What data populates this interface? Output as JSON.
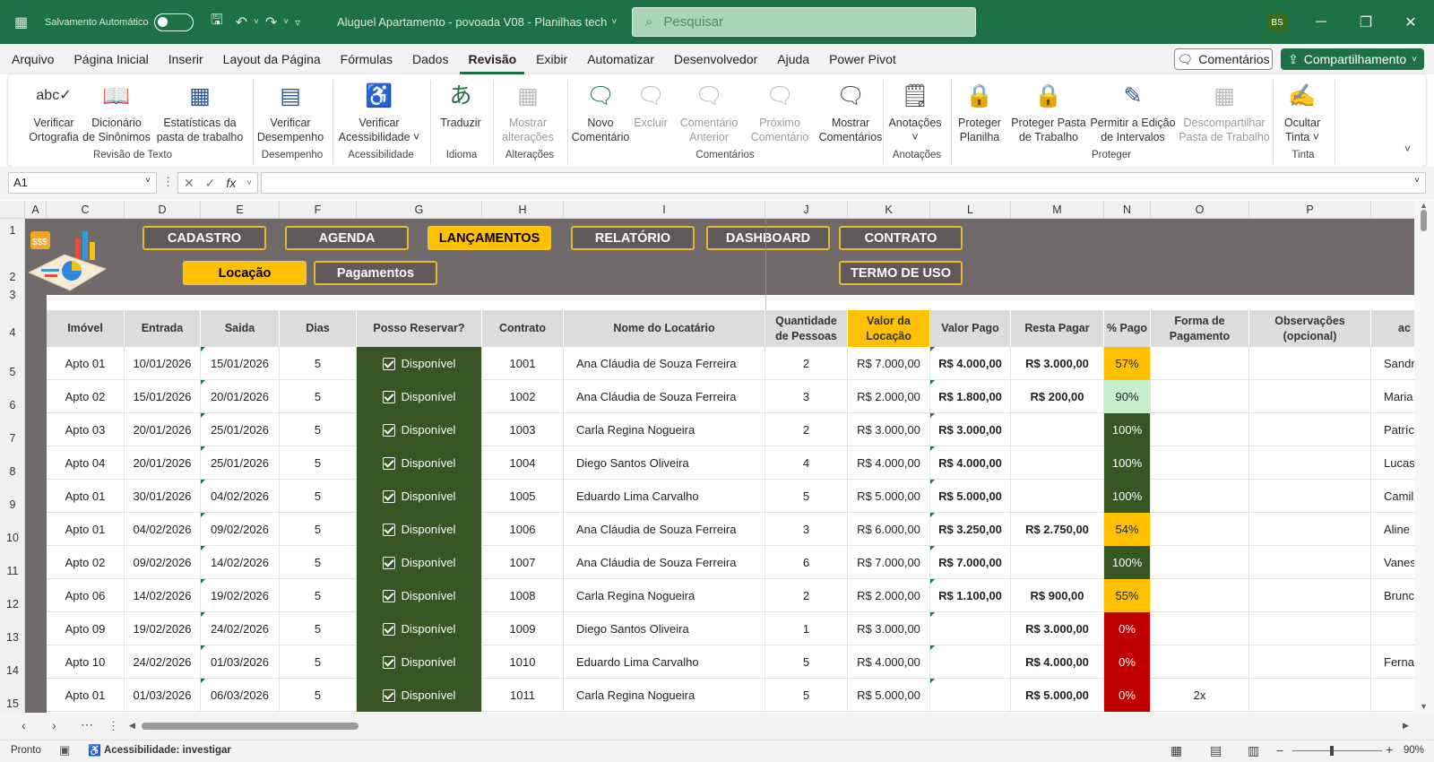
{
  "titlebar": {
    "autosave_label": "Salvamento Automático",
    "doc_title": "Aluguel Apartamento - povoada V08 - Planilhas tech",
    "search_placeholder": "Pesquisar",
    "avatar": "BS"
  },
  "menu": {
    "items": [
      "Arquivo",
      "Página Inicial",
      "Inserir",
      "Layout da Página",
      "Fórmulas",
      "Dados",
      "Revisão",
      "Exibir",
      "Automatizar",
      "Desenvolvedor",
      "Ajuda",
      "Power Pivot"
    ],
    "active": "Revisão",
    "comments_btn": "Comentários",
    "share_btn": "Compartilhamento"
  },
  "ribbon": {
    "items": [
      {
        "label1": "Verificar",
        "label2": "Ortografia",
        "icon": "abc"
      },
      {
        "label1": "Dicionário",
        "label2": "de Sinônimos",
        "icon": "book"
      },
      {
        "label1": "Estatísticas da",
        "label2": "pasta de trabalho",
        "icon": "123"
      },
      {
        "label1": "Verificar",
        "label2": "Desempenho",
        "icon": "perf"
      },
      {
        "label1": "Verificar",
        "label2": "Acessibilidade ˅",
        "icon": "access"
      },
      {
        "label1": "Traduzir",
        "label2": "",
        "icon": "translate"
      },
      {
        "label1": "Mostrar",
        "label2": "alterações",
        "icon": "changes"
      },
      {
        "label1": "Novo",
        "label2": "Comentário",
        "icon": "newcomment"
      },
      {
        "label1": "Excluir",
        "label2": "",
        "icon": "delete"
      },
      {
        "label1": "Comentário",
        "label2": "Anterior",
        "icon": "prev"
      },
      {
        "label1": "Próximo",
        "label2": "Comentário",
        "icon": "next"
      },
      {
        "label1": "Mostrar",
        "label2": "Comentários",
        "icon": "showcomments"
      },
      {
        "label1": "Anotações",
        "label2": "˅",
        "icon": "notes"
      },
      {
        "label1": "Proteger",
        "label2": "Planilha",
        "icon": "protect"
      },
      {
        "label1": "Proteger Pasta",
        "label2": "de Trabalho",
        "icon": "protectwb"
      },
      {
        "label1": "Permitir a Edição",
        "label2": "de Intervalos",
        "icon": "allow"
      },
      {
        "label1": "Descompartilhar",
        "label2": "Pasta de Trabalho",
        "icon": "unshare"
      },
      {
        "label1": "Ocultar",
        "label2": "Tinta ˅",
        "icon": "ink"
      }
    ],
    "groups": [
      "Revisão de Texto",
      "Desempenho",
      "Acessibilidade",
      "Idioma",
      "Alterações",
      "Comentários",
      "Anotações",
      "Proteger",
      "Tinta"
    ]
  },
  "formula": {
    "namebox": "A1",
    "value": ""
  },
  "columns": [
    "A",
    "C",
    "D",
    "E",
    "F",
    "G",
    "H",
    "I",
    "J",
    "K",
    "L",
    "M",
    "N",
    "O",
    "P"
  ],
  "rows": [
    "1",
    "2",
    "3",
    "4",
    "5",
    "6",
    "7",
    "8",
    "9",
    "10",
    "11",
    "12",
    "13",
    "14",
    "15"
  ],
  "nav": {
    "cadastro": "CADASTRO",
    "agenda": "AGENDA",
    "lancamentos": "LANÇAMENTOS",
    "relatorio": "RELATÓRIO",
    "dashboard": "DASHBOARD",
    "contrato": "CONTRATO",
    "locacao": "Locação",
    "pagamentos": "Pagamentos",
    "termo": "TERMO DE USO"
  },
  "table": {
    "headers": [
      "Imóvel",
      "Entrada",
      "Saida",
      "Dias",
      "Posso Reservar?",
      "Contrato",
      "Nome do Locatário",
      "Quantidade de Pessoas",
      "Valor da Locação",
      "Valor Pago",
      "Resta Pagar",
      "% Pago",
      "Forma de Pagamento",
      "Observações (opcional)",
      "ac"
    ],
    "rows": [
      {
        "imovel": "Apto 01",
        "entrada": "10/01/2026",
        "saida": "15/01/2026",
        "dias": "5",
        "reservar": "Disponível",
        "contrato": "1001",
        "nome": "Ana Cláudia de Souza Ferreira",
        "pessoas": "2",
        "valor": "R$ 7.000,00",
        "pago": "R$ 4.000,00",
        "resta": "R$ 3.000,00",
        "pct": "57%",
        "pct_class": "pct-y",
        "forma": "",
        "obs": "",
        "extra": "Sandr"
      },
      {
        "imovel": "Apto 02",
        "entrada": "15/01/2026",
        "saida": "20/01/2026",
        "dias": "5",
        "reservar": "Disponível",
        "contrato": "1002",
        "nome": "Ana Cláudia de Souza Ferreira",
        "pessoas": "3",
        "valor": "R$ 2.000,00",
        "pago": "R$ 1.800,00",
        "resta": "R$ 200,00",
        "pct": "90%",
        "pct_class": "pct-lg",
        "forma": "",
        "obs": "",
        "extra": "Maria"
      },
      {
        "imovel": "Apto 03",
        "entrada": "20/01/2026",
        "saida": "25/01/2026",
        "dias": "5",
        "reservar": "Disponível",
        "contrato": "1003",
        "nome": "Carla Regina Nogueira",
        "pessoas": "2",
        "valor": "R$ 3.000,00",
        "pago": "R$ 3.000,00",
        "resta": "",
        "pct": "100%",
        "pct_class": "pct-dg",
        "forma": "",
        "obs": "",
        "extra": "Patríc"
      },
      {
        "imovel": "Apto 04",
        "entrada": "20/01/2026",
        "saida": "25/01/2026",
        "dias": "5",
        "reservar": "Disponível",
        "contrato": "1004",
        "nome": "Diego Santos Oliveira",
        "pessoas": "4",
        "valor": "R$ 4.000,00",
        "pago": "R$ 4.000,00",
        "resta": "",
        "pct": "100%",
        "pct_class": "pct-dg",
        "forma": "",
        "obs": "",
        "extra": "Lucas"
      },
      {
        "imovel": "Apto 01",
        "entrada": "30/01/2026",
        "saida": "04/02/2026",
        "dias": "5",
        "reservar": "Disponível",
        "contrato": "1005",
        "nome": "Eduardo Lima Carvalho",
        "pessoas": "5",
        "valor": "R$ 5.000,00",
        "pago": "R$ 5.000,00",
        "resta": "",
        "pct": "100%",
        "pct_class": "pct-dg",
        "forma": "",
        "obs": "",
        "extra": "Camil"
      },
      {
        "imovel": "Apto 01",
        "entrada": "04/02/2026",
        "saida": "09/02/2026",
        "dias": "5",
        "reservar": "Disponível",
        "contrato": "1006",
        "nome": "Ana Cláudia de Souza Ferreira",
        "pessoas": "3",
        "valor": "R$ 6.000,00",
        "pago": "R$ 3.250,00",
        "resta": "R$ 2.750,00",
        "pct": "54%",
        "pct_class": "pct-y",
        "forma": "",
        "obs": "",
        "extra": "Aline"
      },
      {
        "imovel": "Apto 02",
        "entrada": "09/02/2026",
        "saida": "14/02/2026",
        "dias": "5",
        "reservar": "Disponível",
        "contrato": "1007",
        "nome": "Ana Cláudia de Souza Ferreira",
        "pessoas": "6",
        "valor": "R$ 7.000,00",
        "pago": "R$ 7.000,00",
        "resta": "",
        "pct": "100%",
        "pct_class": "pct-dg",
        "forma": "",
        "obs": "",
        "extra": "Vanes"
      },
      {
        "imovel": "Apto 06",
        "entrada": "14/02/2026",
        "saida": "19/02/2026",
        "dias": "5",
        "reservar": "Disponível",
        "contrato": "1008",
        "nome": "Carla Regina Nogueira",
        "pessoas": "2",
        "valor": "R$ 2.000,00",
        "pago": "R$ 1.100,00",
        "resta": "R$ 900,00",
        "pct": "55%",
        "pct_class": "pct-y",
        "forma": "",
        "obs": "",
        "extra": "Brunc"
      },
      {
        "imovel": "Apto 09",
        "entrada": "19/02/2026",
        "saida": "24/02/2026",
        "dias": "5",
        "reservar": "Disponível",
        "contrato": "1009",
        "nome": "Diego Santos Oliveira",
        "pessoas": "1",
        "valor": "R$ 3.000,00",
        "pago": "",
        "resta": "R$ 3.000,00",
        "pct": "0%",
        "pct_class": "pct-r",
        "forma": "",
        "obs": "",
        "extra": ""
      },
      {
        "imovel": "Apto 10",
        "entrada": "24/02/2026",
        "saida": "01/03/2026",
        "dias": "5",
        "reservar": "Disponível",
        "contrato": "1010",
        "nome": "Eduardo Lima Carvalho",
        "pessoas": "5",
        "valor": "R$ 4.000,00",
        "pago": "",
        "resta": "R$ 4.000,00",
        "pct": "0%",
        "pct_class": "pct-r",
        "forma": "",
        "obs": "",
        "extra": "Ferna"
      },
      {
        "imovel": "Apto 01",
        "entrada": "01/03/2026",
        "saida": "06/03/2026",
        "dias": "5",
        "reservar": "Disponível",
        "contrato": "1011",
        "nome": "Carla Regina Nogueira",
        "pessoas": "5",
        "valor": "R$ 5.000,00",
        "pago": "",
        "resta": "R$ 5.000,00",
        "pct": "0%",
        "pct_class": "pct-r",
        "forma": "2x",
        "obs": "",
        "extra": ""
      }
    ]
  },
  "status": {
    "ready": "Pronto",
    "accessibility": "Acessibilidade: investigar",
    "zoom": "90%"
  }
}
